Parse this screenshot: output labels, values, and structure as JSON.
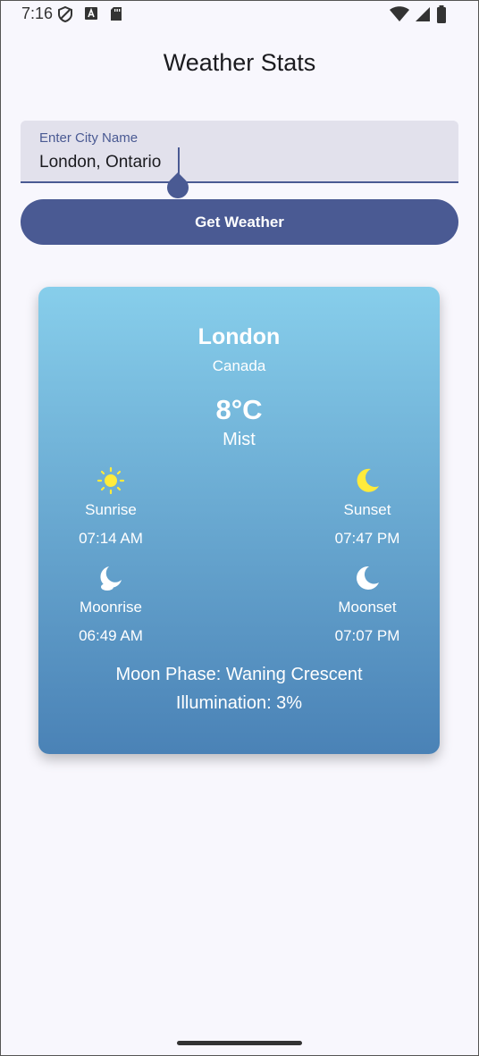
{
  "status_bar": {
    "time": "7:16"
  },
  "app": {
    "title": "Weather Stats"
  },
  "search": {
    "label": "Enter City Name",
    "value": "London, Ontario"
  },
  "button": {
    "label": "Get Weather"
  },
  "weather": {
    "city": "London",
    "country": "Canada",
    "temperature": "8°C",
    "condition": "Mist",
    "sunrise": {
      "label": "Sunrise",
      "time": "07:14 AM",
      "icon": "sun-icon"
    },
    "sunset": {
      "label": "Sunset",
      "time": "07:47 PM",
      "icon": "crescent-moon-icon"
    },
    "moonrise": {
      "label": "Moonrise",
      "time": "06:49 AM",
      "icon": "moonrise-icon"
    },
    "moonset": {
      "label": "Moonset",
      "time": "07:07 PM",
      "icon": "moonset-icon"
    },
    "moon_phase": "Moon Phase: Waning Crescent",
    "illumination": "Illumination: 3%"
  },
  "colors": {
    "primary": "#4a5a93",
    "card_top": "#87ceeb",
    "card_bottom": "#4a82b6",
    "sun_yellow": "#ffeb3b"
  }
}
